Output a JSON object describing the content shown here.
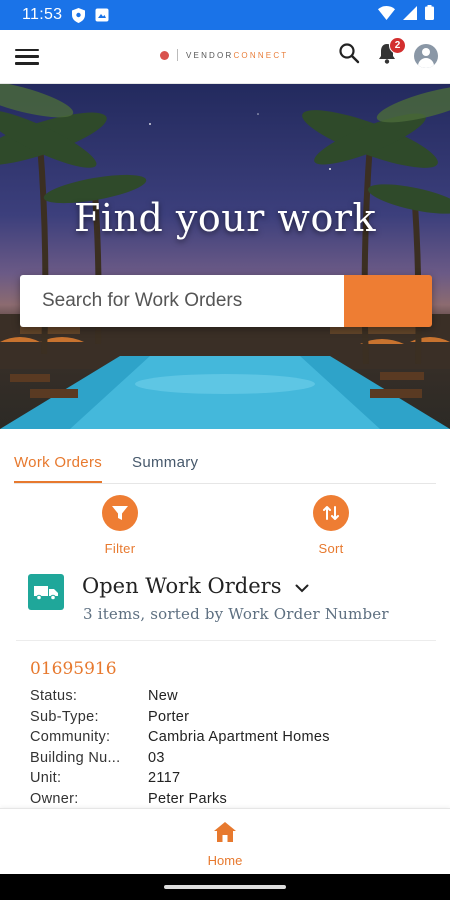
{
  "status_bar": {
    "time": "11:53"
  },
  "header": {
    "logo_prefix": "VENDOR",
    "logo_suffix": "CONNECT",
    "notification_count": "2"
  },
  "hero": {
    "title": "Find your work",
    "search_placeholder": "Search for Work Orders"
  },
  "tabs": [
    {
      "label": "Work Orders",
      "active": true
    },
    {
      "label": "Summary",
      "active": false
    }
  ],
  "actions": {
    "filter_label": "Filter",
    "sort_label": "Sort"
  },
  "list": {
    "title": "Open Work Orders",
    "subtitle": "3 items, sorted by Work Order Number"
  },
  "records": [
    {
      "id": "01695916",
      "fields": [
        {
          "label": "Status:",
          "value": "New"
        },
        {
          "label": "Sub-Type:",
          "value": "Porter"
        },
        {
          "label": "Community:",
          "value": "Cambria Apartment Homes"
        },
        {
          "label": "Building Nu...",
          "value": "03"
        },
        {
          "label": "Unit:",
          "value": "2117"
        },
        {
          "label": "Owner:",
          "value": "Peter Parks"
        }
      ]
    }
  ],
  "bottom_nav": {
    "home_label": "Home"
  },
  "colors": {
    "accent": "#ee7d33",
    "status_bar": "#1a73e8",
    "teal": "#1fa79a"
  }
}
